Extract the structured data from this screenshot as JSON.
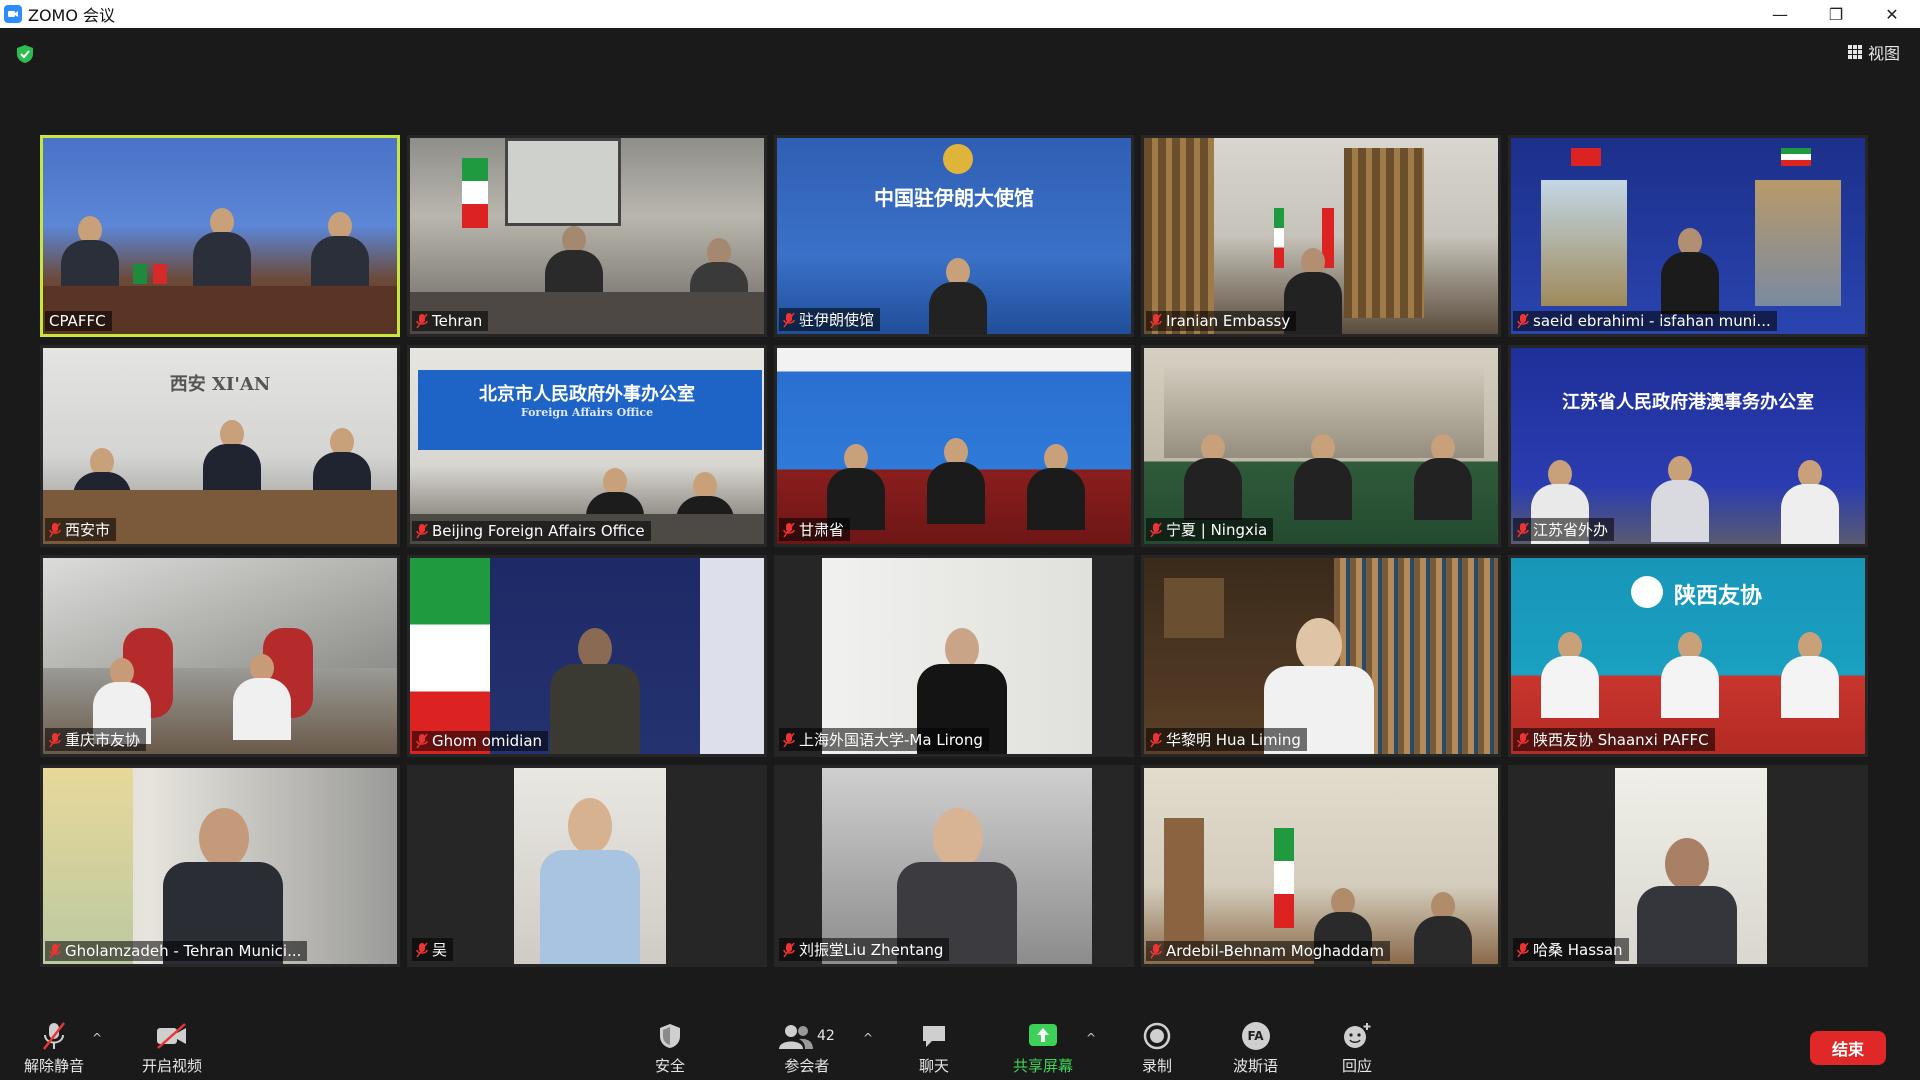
{
  "window": {
    "title": "ZOMO 会议",
    "minimize_glyph": "—",
    "restore_glyph": "❐",
    "close_glyph": "✕"
  },
  "meeting": {
    "view_label": "视图",
    "security_badge_color": "#2dbd4e"
  },
  "participants": [
    {
      "name": "CPAFFC",
      "muted": false,
      "active": true
    },
    {
      "name": "Tehran",
      "muted": true
    },
    {
      "name": "驻伊朗使馆",
      "muted": true
    },
    {
      "name": "Iranian Embassy",
      "muted": true
    },
    {
      "name": "saeid ebrahimi - isfahan muni...",
      "muted": true
    },
    {
      "name": "西安市",
      "muted": true
    },
    {
      "name": "Beijing Foreign Affairs Office",
      "muted": true
    },
    {
      "name": "甘肃省",
      "muted": true
    },
    {
      "name": "宁夏 | Ningxia",
      "muted": true
    },
    {
      "name": "江苏省外办",
      "muted": true
    },
    {
      "name": "重庆市友协",
      "muted": true
    },
    {
      "name": "Ghom omidian",
      "muted": true
    },
    {
      "name": "上海外国语大学-Ma Lirong",
      "muted": true
    },
    {
      "name": "华黎明 Hua Liming",
      "muted": true
    },
    {
      "name": "陕西友协 Shaanxi PAFFC",
      "muted": true
    },
    {
      "name": "Gholamzadeh - Tehran Munici...",
      "muted": true
    },
    {
      "name": "吴",
      "muted": true
    },
    {
      "name": "刘振堂Liu Zhentang",
      "muted": true
    },
    {
      "name": "Ardebil-Behnam Moghaddam",
      "muted": true
    },
    {
      "name": "哈桑  Hassan",
      "muted": true
    }
  ],
  "video_text": {
    "xian_sign": "西安 XI'AN",
    "embassy_sign": "中国驻伊朗大使馆",
    "beijing_sign": "北京市人民政府外事办公室",
    "beijing_sign_en": "Foreign Affairs Office",
    "jiangsu_sign": "江苏省人民政府港澳事务办公室",
    "shaanxi_sign": "陕西友协"
  },
  "toolbar": {
    "unmute_label": "解除静音",
    "start_video_label": "开启视频",
    "security_label": "安全",
    "participants_label": "参会者",
    "participants_count": "42",
    "chat_label": "聊天",
    "share_label": "共享屏幕",
    "record_label": "录制",
    "language_label": "波斯语",
    "language_badge": "FA",
    "reactions_label": "回应",
    "end_label": "结束",
    "share_color": "#3dd15a",
    "end_color": "#e02828"
  }
}
